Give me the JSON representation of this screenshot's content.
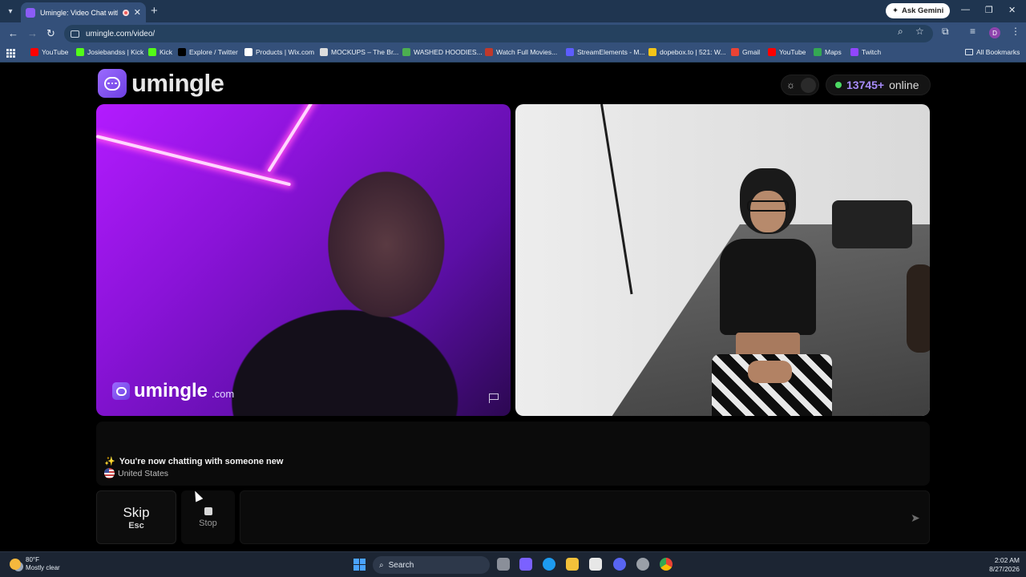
{
  "browser": {
    "tab_title": "Umingle: Video Chat with S",
    "url": "umingle.com/video/",
    "ask_gemini": "Ask Gemini",
    "profile_initial": "D",
    "bookmarks": [
      {
        "label": "YouTube",
        "color": "#ff0000"
      },
      {
        "label": "Josiebandss | Kick",
        "color": "#53fc18"
      },
      {
        "label": "Kick",
        "color": "#53fc18"
      },
      {
        "label": "Explore / Twitter",
        "color": "#000000"
      },
      {
        "label": "Products | Wix.com",
        "color": "#ffffff"
      },
      {
        "label": "MOCKUPS – The Br...",
        "color": "#dddddd"
      },
      {
        "label": "WASHED HOODIES...",
        "color": "#4caf50"
      },
      {
        "label": "Watch Full Movies...",
        "color": "#c0392b"
      },
      {
        "label": "StreamElements - M...",
        "color": "#5d5dff"
      },
      {
        "label": "dopebox.to | 521: W...",
        "color": "#f5c518"
      },
      {
        "label": "Gmail",
        "color": "#ea4335"
      },
      {
        "label": "YouTube",
        "color": "#ff0000"
      },
      {
        "label": "Maps",
        "color": "#34a853"
      },
      {
        "label": "Twitch",
        "color": "#9146ff"
      }
    ],
    "all_bookmarks": "All Bookmarks"
  },
  "site": {
    "logo_text": "umingle",
    "online_count": "13745+",
    "online_label": "online",
    "watermark_name": "umingle",
    "watermark_domain": ".com",
    "system_message": "You're now chatting with someone new",
    "country": "United States",
    "skip_label": "Skip",
    "skip_key": "Esc",
    "stop_label": "Stop",
    "message_value": ""
  },
  "taskbar": {
    "temperature": "80°F",
    "weather": "Mostly clear",
    "search_placeholder": "Search",
    "time": "2:02 AM",
    "date": "8/27/2026"
  },
  "colors": {
    "accent": "#a78bfa",
    "online_dot": "#4cd964"
  }
}
